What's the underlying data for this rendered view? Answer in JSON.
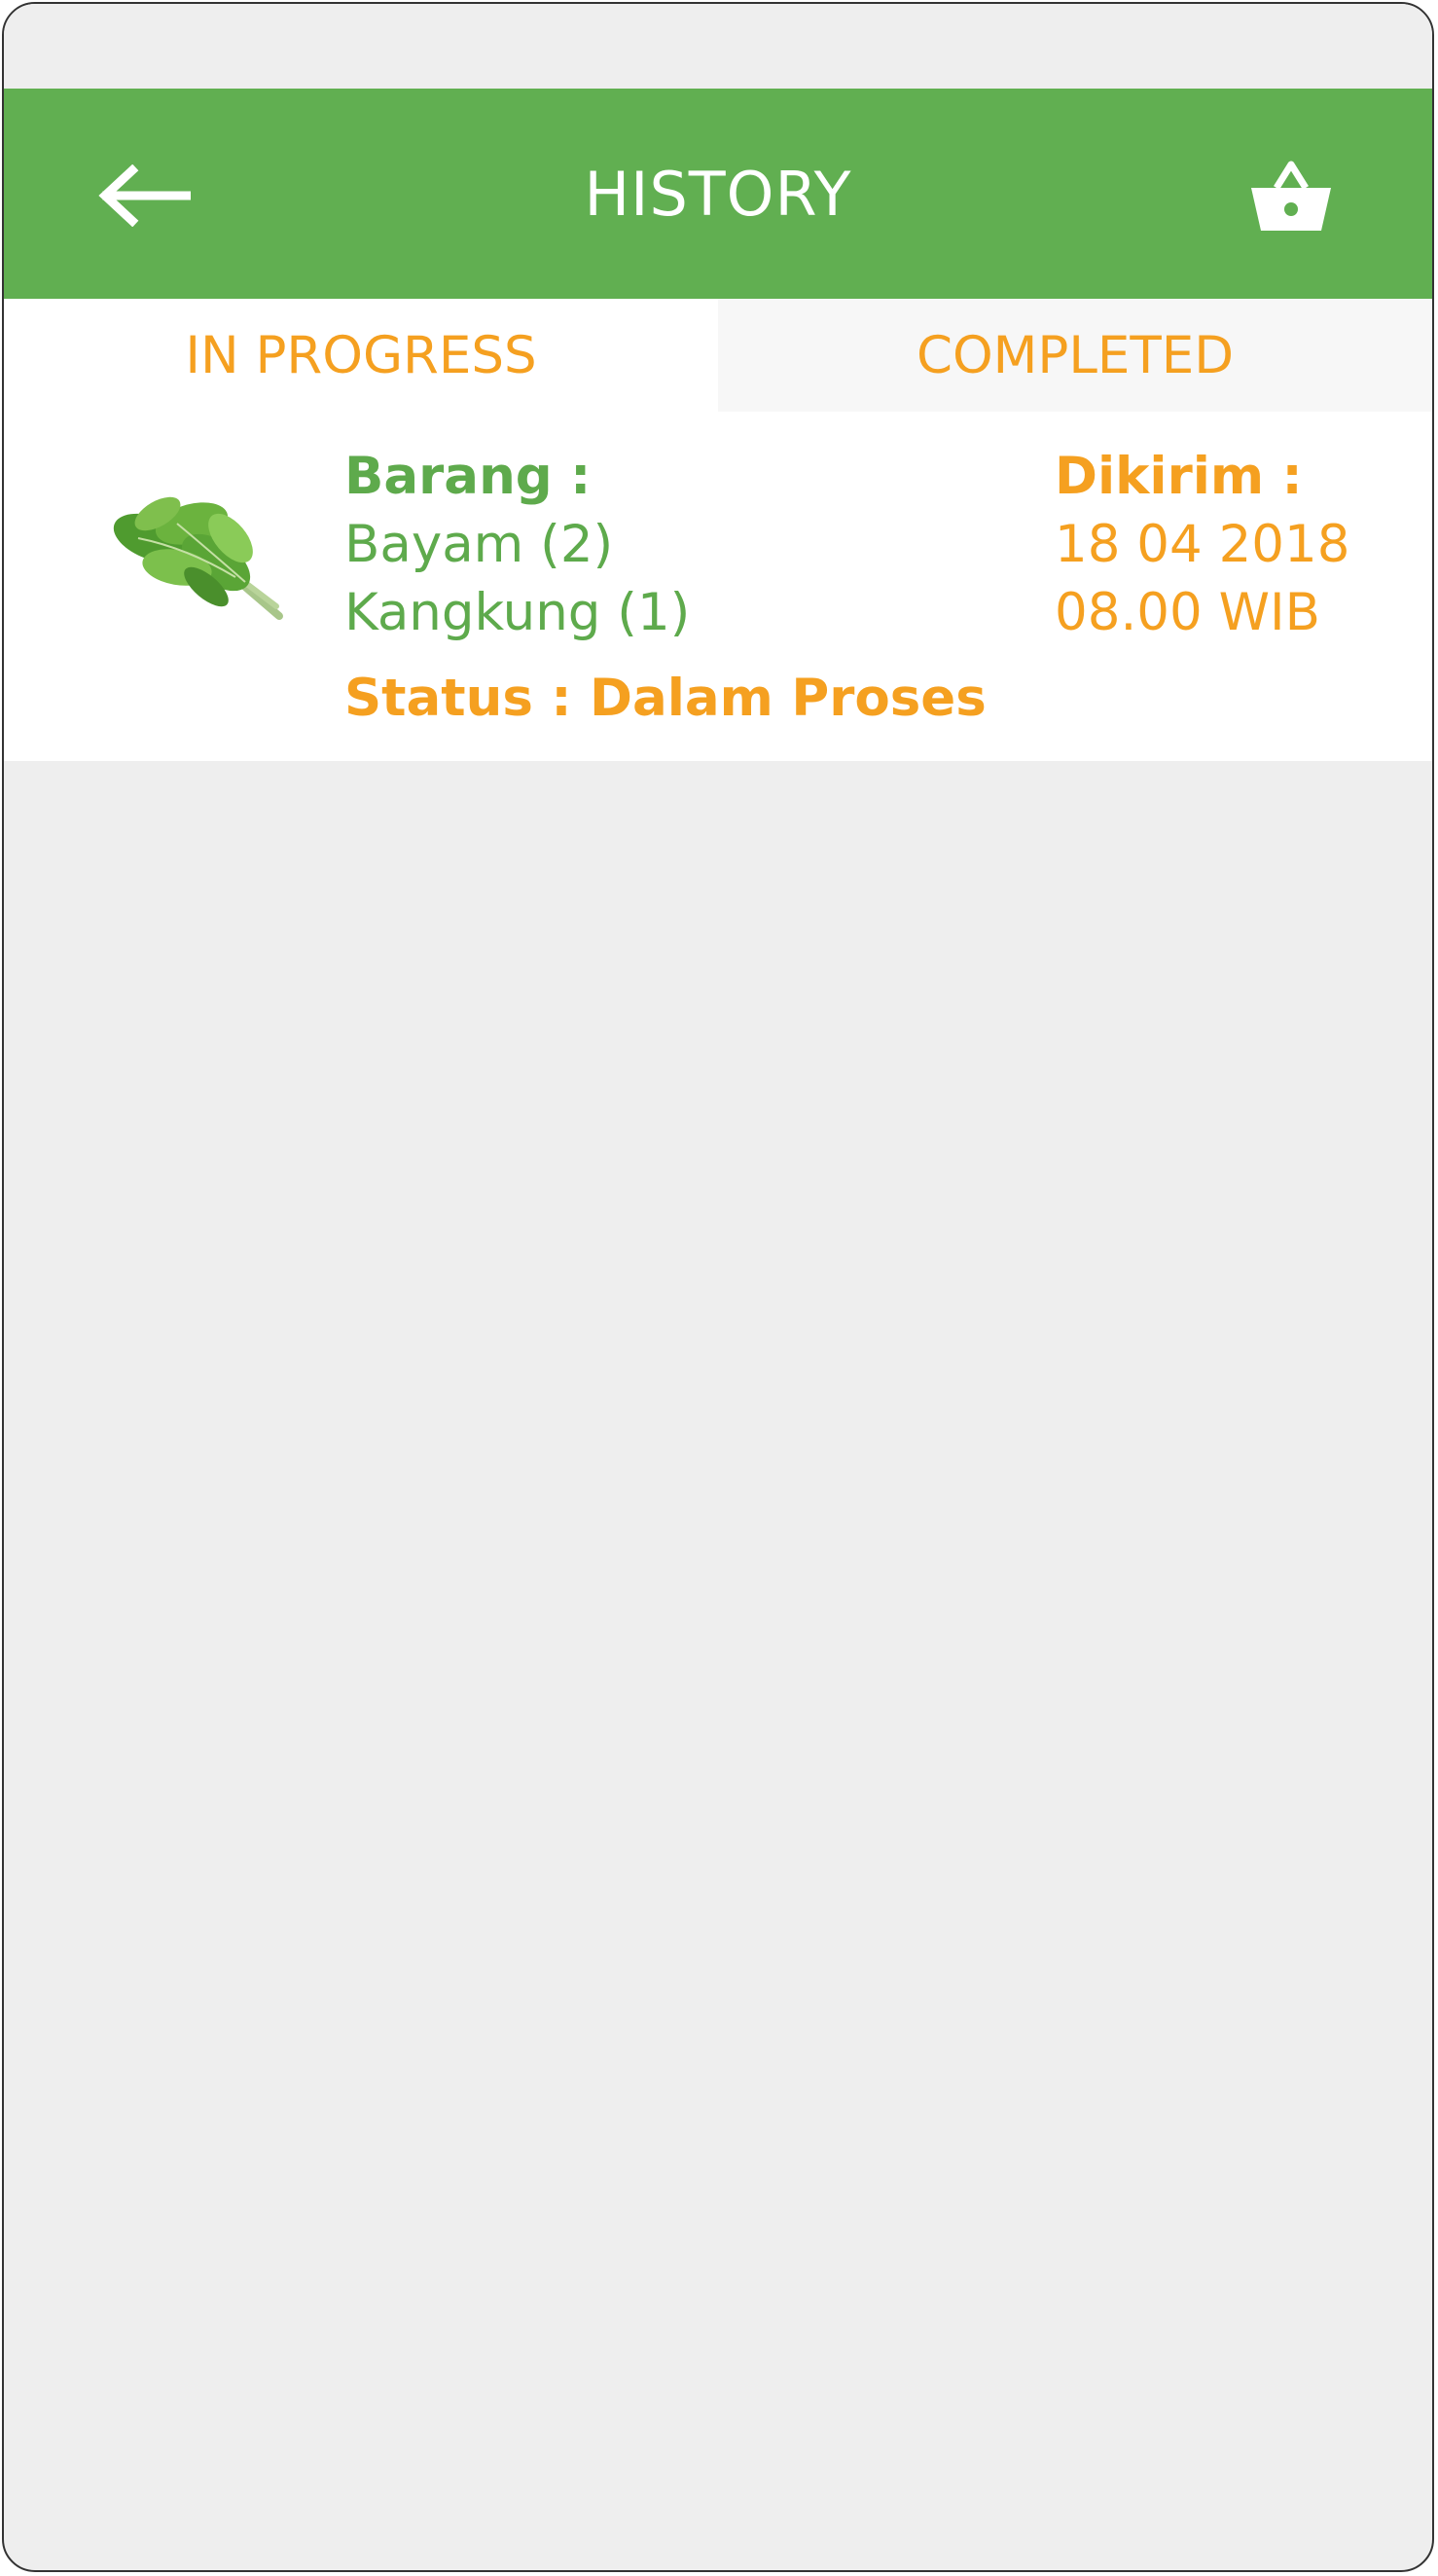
{
  "header": {
    "title": "HISTORY",
    "back_icon": "arrow-left-icon",
    "cart_icon": "basket-icon"
  },
  "tabs": [
    {
      "label": "IN PROGRESS",
      "active": true
    },
    {
      "label": "COMPLETED",
      "active": false
    }
  ],
  "orders": [
    {
      "image_icon": "spinach-image",
      "items_label": "Barang :",
      "items": [
        "Bayam (2)",
        "Kangkung (1)"
      ],
      "delivery_label": "Dikirim :",
      "delivery_date": "18 04 2018",
      "delivery_time": "08.00 WIB",
      "status": "Status : Dalam Proses"
    }
  ],
  "colors": {
    "primary": "#61af51",
    "accent": "#f5a020",
    "background": "#eeeeee"
  }
}
